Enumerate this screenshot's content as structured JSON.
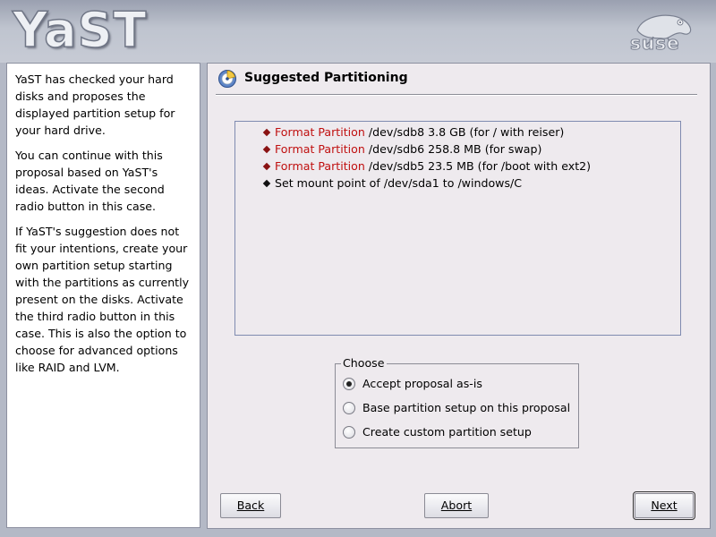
{
  "header": {
    "app_logo": "YaST",
    "vendor_logo": "suse",
    "vendor_logo_icon": "gecko-chameleon-icon"
  },
  "help": {
    "paragraphs": [
      "YaST has checked your hard disks and proposes the displayed partition setup for your hard drive.",
      "You can continue with this proposal based on YaST's ideas. Activate the second radio button in this case.",
      "If YaST's suggestion does not fit your intentions, create your own partition setup starting with the partitions as currently present on the disks. Activate the third radio button in this case. This is also the option to choose for advanced options like RAID and LVM."
    ]
  },
  "dialog": {
    "title": "Suggested Partitioning",
    "title_icon": "hard-disk-icon",
    "proposal_items": [
      {
        "action": "Format Partition",
        "detail": " /dev/sdb8 3.8 GB (for / with reiser)"
      },
      {
        "action": "Format Partition",
        "detail": " /dev/sdb6 258.8 MB (for swap)"
      },
      {
        "action": "Format Partition",
        "detail": " /dev/sdb5 23.5 MB (for /boot with ext2)"
      },
      {
        "action": "",
        "detail": "Set mount point of /dev/sda1 to /windows/C"
      }
    ],
    "choose": {
      "legend": "Choose",
      "options": [
        {
          "label": "Accept proposal as-is",
          "checked": true
        },
        {
          "label": "Base partition setup on this proposal",
          "checked": false
        },
        {
          "label": "Create custom partition setup",
          "checked": false
        }
      ]
    }
  },
  "buttons": {
    "back": "Back",
    "abort": "Abort",
    "next": "Next"
  },
  "colors": {
    "action_text": "#c01010",
    "bullet_action": "#8a1212",
    "panel_bg": "#eeeaee"
  }
}
